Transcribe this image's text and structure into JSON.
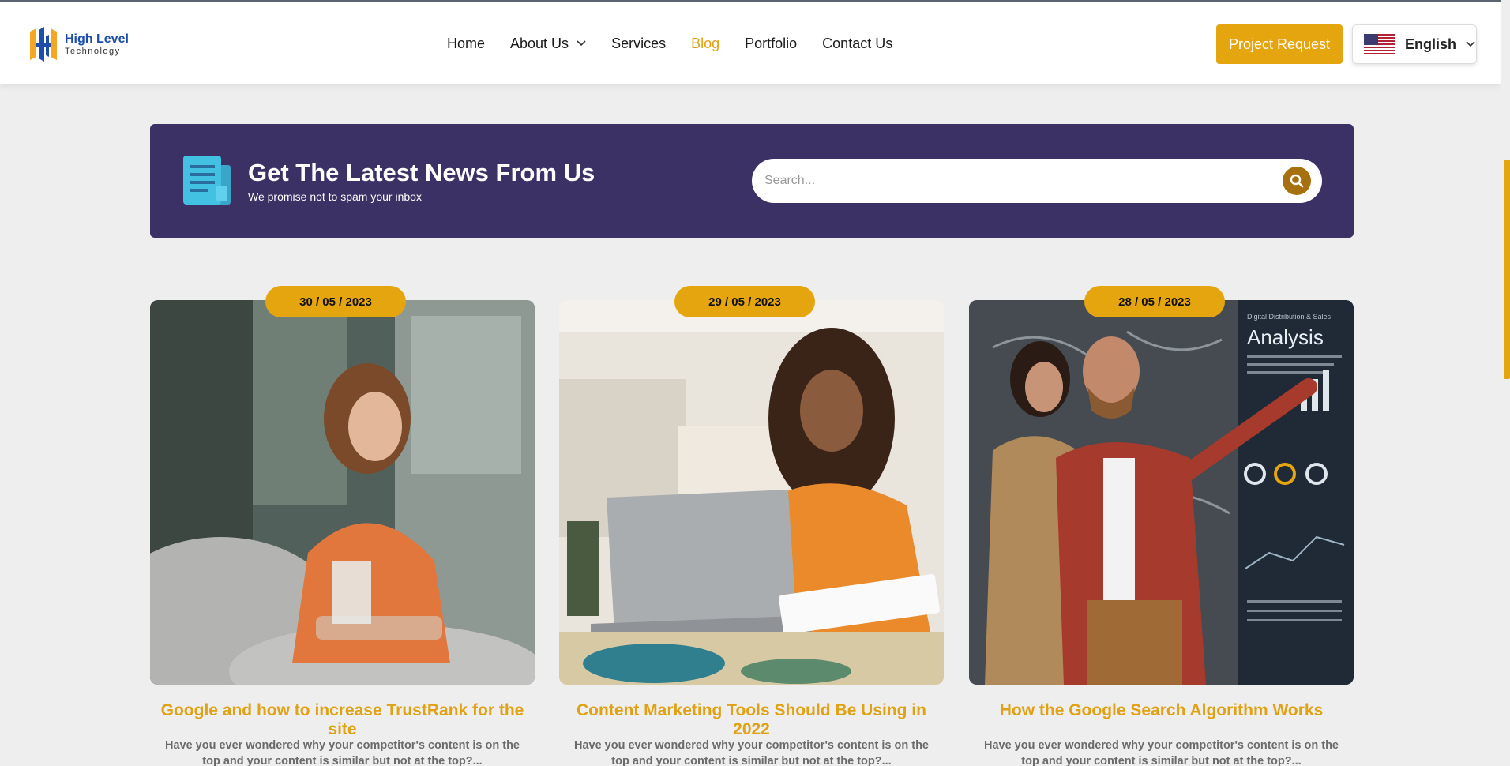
{
  "brand": {
    "name": "High Level",
    "tagline": "Technology",
    "colors": {
      "accent": "#e5a50f",
      "banner": "#3b3165",
      "logo_blue": "#1d4fa8",
      "logo_orange": "#f5a623"
    }
  },
  "nav": {
    "items": [
      {
        "label": "Home",
        "active": false
      },
      {
        "label": "About Us",
        "active": false,
        "has_dropdown": true
      },
      {
        "label": "Services",
        "active": false
      },
      {
        "label": "Blog",
        "active": true
      },
      {
        "label": "Portfolio",
        "active": false
      },
      {
        "label": "Contact Us",
        "active": false
      }
    ],
    "cta_label": "Project Request",
    "language": {
      "label": "English",
      "flag_icon": "us-flag-icon"
    }
  },
  "banner": {
    "icon": "newspaper-icon",
    "title": "Get The Latest News From Us",
    "subtitle": "We promise not to spam your inbox",
    "search_placeholder": "Search...",
    "search_icon": "search-icon"
  },
  "posts": [
    {
      "date": "30 / 05 / 2023",
      "title": "Google and how to increase TrustRank for the site",
      "excerpt": "Have you ever wondered why your competitor's content is on the top and your content is similar but not at the top?..."
    },
    {
      "date": "29 / 05 / 2023",
      "title": "Content Marketing Tools Should Be Using in 2022",
      "excerpt": "Have you ever wondered why your competitor's content is on the top and your content is similar but not at the top?..."
    },
    {
      "date": "28 / 05 / 2023",
      "title": "How the Google Search Algorithm Works",
      "excerpt": "Have you ever wondered why your competitor's content is on the top and your content is similar but not at the top?..."
    }
  ],
  "post_image_texts": {
    "analysis_heading": "Analysis",
    "analysis_sub": "Digital Distribution & Sales"
  }
}
